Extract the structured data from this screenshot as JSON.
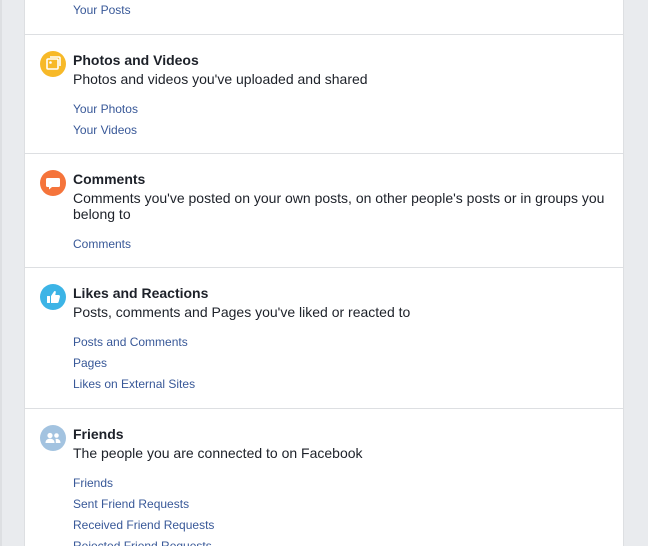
{
  "sections": {
    "posts": {
      "links": [
        "Your Posts"
      ]
    },
    "photos": {
      "title": "Photos and Videos",
      "description": "Photos and videos you've uploaded and shared",
      "icon": "photos-icon",
      "icon_color": "#f7b928",
      "links": [
        "Your Photos",
        "Your Videos"
      ]
    },
    "comments": {
      "title": "Comments",
      "description": "Comments you've posted on your own posts, on other people's posts or in groups you belong to",
      "icon": "comment-bubble-icon",
      "icon_color": "#f5743b",
      "links": [
        "Comments"
      ]
    },
    "likes": {
      "title": "Likes and Reactions",
      "description": "Posts, comments and Pages you've liked or reacted to",
      "icon": "thumbs-up-icon",
      "icon_color": "#3cb4e6",
      "links": [
        "Posts and Comments",
        "Pages",
        "Likes on External Sites"
      ]
    },
    "friends": {
      "title": "Friends",
      "description": "The people you are connected to on Facebook",
      "icon": "friends-icon",
      "icon_color": "#a3c3e0",
      "links": [
        "Friends",
        "Sent Friend Requests",
        "Received Friend Requests",
        "Rejected Friend Requests"
      ]
    }
  }
}
